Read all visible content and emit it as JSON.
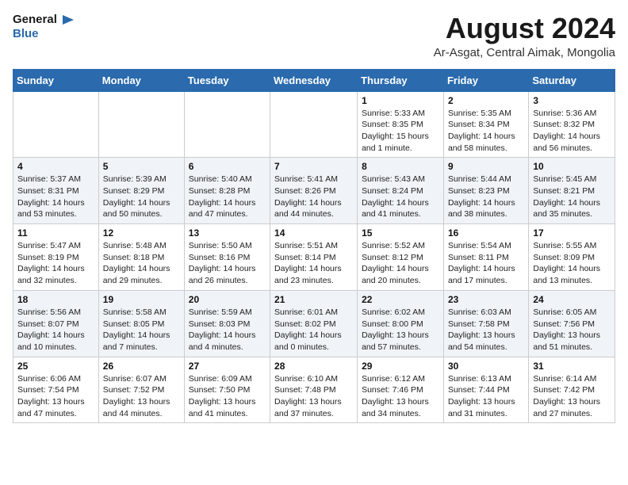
{
  "header": {
    "logo_general": "General",
    "logo_blue": "Blue",
    "month_year": "August 2024",
    "location": "Ar-Asgat, Central Aimak, Mongolia"
  },
  "weekdays": [
    "Sunday",
    "Monday",
    "Tuesday",
    "Wednesday",
    "Thursday",
    "Friday",
    "Saturday"
  ],
  "weeks": [
    [
      {
        "day": "",
        "info": ""
      },
      {
        "day": "",
        "info": ""
      },
      {
        "day": "",
        "info": ""
      },
      {
        "day": "",
        "info": ""
      },
      {
        "day": "1",
        "info": "Sunrise: 5:33 AM\nSunset: 8:35 PM\nDaylight: 15 hours\nand 1 minute."
      },
      {
        "day": "2",
        "info": "Sunrise: 5:35 AM\nSunset: 8:34 PM\nDaylight: 14 hours\nand 58 minutes."
      },
      {
        "day": "3",
        "info": "Sunrise: 5:36 AM\nSunset: 8:32 PM\nDaylight: 14 hours\nand 56 minutes."
      }
    ],
    [
      {
        "day": "4",
        "info": "Sunrise: 5:37 AM\nSunset: 8:31 PM\nDaylight: 14 hours\nand 53 minutes."
      },
      {
        "day": "5",
        "info": "Sunrise: 5:39 AM\nSunset: 8:29 PM\nDaylight: 14 hours\nand 50 minutes."
      },
      {
        "day": "6",
        "info": "Sunrise: 5:40 AM\nSunset: 8:28 PM\nDaylight: 14 hours\nand 47 minutes."
      },
      {
        "day": "7",
        "info": "Sunrise: 5:41 AM\nSunset: 8:26 PM\nDaylight: 14 hours\nand 44 minutes."
      },
      {
        "day": "8",
        "info": "Sunrise: 5:43 AM\nSunset: 8:24 PM\nDaylight: 14 hours\nand 41 minutes."
      },
      {
        "day": "9",
        "info": "Sunrise: 5:44 AM\nSunset: 8:23 PM\nDaylight: 14 hours\nand 38 minutes."
      },
      {
        "day": "10",
        "info": "Sunrise: 5:45 AM\nSunset: 8:21 PM\nDaylight: 14 hours\nand 35 minutes."
      }
    ],
    [
      {
        "day": "11",
        "info": "Sunrise: 5:47 AM\nSunset: 8:19 PM\nDaylight: 14 hours\nand 32 minutes."
      },
      {
        "day": "12",
        "info": "Sunrise: 5:48 AM\nSunset: 8:18 PM\nDaylight: 14 hours\nand 29 minutes."
      },
      {
        "day": "13",
        "info": "Sunrise: 5:50 AM\nSunset: 8:16 PM\nDaylight: 14 hours\nand 26 minutes."
      },
      {
        "day": "14",
        "info": "Sunrise: 5:51 AM\nSunset: 8:14 PM\nDaylight: 14 hours\nand 23 minutes."
      },
      {
        "day": "15",
        "info": "Sunrise: 5:52 AM\nSunset: 8:12 PM\nDaylight: 14 hours\nand 20 minutes."
      },
      {
        "day": "16",
        "info": "Sunrise: 5:54 AM\nSunset: 8:11 PM\nDaylight: 14 hours\nand 17 minutes."
      },
      {
        "day": "17",
        "info": "Sunrise: 5:55 AM\nSunset: 8:09 PM\nDaylight: 14 hours\nand 13 minutes."
      }
    ],
    [
      {
        "day": "18",
        "info": "Sunrise: 5:56 AM\nSunset: 8:07 PM\nDaylight: 14 hours\nand 10 minutes."
      },
      {
        "day": "19",
        "info": "Sunrise: 5:58 AM\nSunset: 8:05 PM\nDaylight: 14 hours\nand 7 minutes."
      },
      {
        "day": "20",
        "info": "Sunrise: 5:59 AM\nSunset: 8:03 PM\nDaylight: 14 hours\nand 4 minutes."
      },
      {
        "day": "21",
        "info": "Sunrise: 6:01 AM\nSunset: 8:02 PM\nDaylight: 14 hours\nand 0 minutes."
      },
      {
        "day": "22",
        "info": "Sunrise: 6:02 AM\nSunset: 8:00 PM\nDaylight: 13 hours\nand 57 minutes."
      },
      {
        "day": "23",
        "info": "Sunrise: 6:03 AM\nSunset: 7:58 PM\nDaylight: 13 hours\nand 54 minutes."
      },
      {
        "day": "24",
        "info": "Sunrise: 6:05 AM\nSunset: 7:56 PM\nDaylight: 13 hours\nand 51 minutes."
      }
    ],
    [
      {
        "day": "25",
        "info": "Sunrise: 6:06 AM\nSunset: 7:54 PM\nDaylight: 13 hours\nand 47 minutes."
      },
      {
        "day": "26",
        "info": "Sunrise: 6:07 AM\nSunset: 7:52 PM\nDaylight: 13 hours\nand 44 minutes."
      },
      {
        "day": "27",
        "info": "Sunrise: 6:09 AM\nSunset: 7:50 PM\nDaylight: 13 hours\nand 41 minutes."
      },
      {
        "day": "28",
        "info": "Sunrise: 6:10 AM\nSunset: 7:48 PM\nDaylight: 13 hours\nand 37 minutes."
      },
      {
        "day": "29",
        "info": "Sunrise: 6:12 AM\nSunset: 7:46 PM\nDaylight: 13 hours\nand 34 minutes."
      },
      {
        "day": "30",
        "info": "Sunrise: 6:13 AM\nSunset: 7:44 PM\nDaylight: 13 hours\nand 31 minutes."
      },
      {
        "day": "31",
        "info": "Sunrise: 6:14 AM\nSunset: 7:42 PM\nDaylight: 13 hours\nand 27 minutes."
      }
    ]
  ]
}
